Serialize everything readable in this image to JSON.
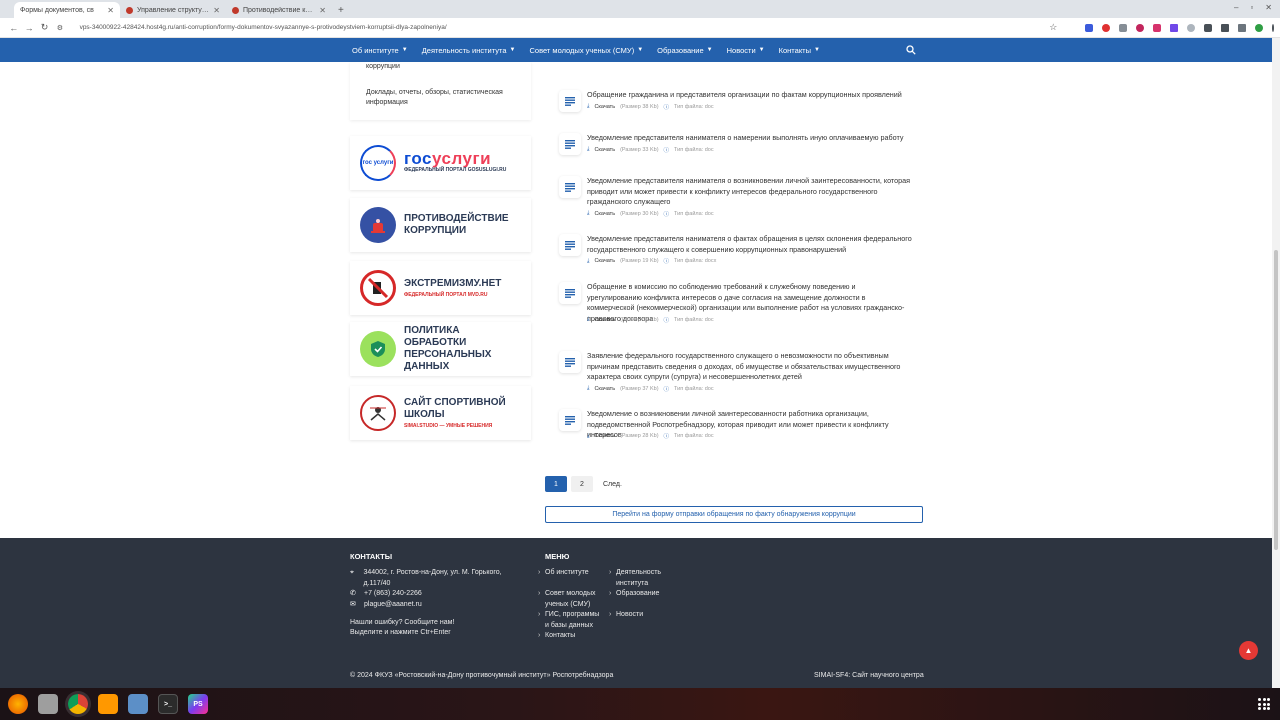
{
  "browser": {
    "tabs": [
      {
        "title": "Формы документов, св",
        "active": true
      },
      {
        "title": "Управление структуро",
        "active": false
      },
      {
        "title": "Противодействие корр",
        "active": false
      }
    ],
    "new_tab": "+",
    "url": "vps-34000922-428424.host4g.ru/anti-corruption/formy-dokumentov-svyazannye-s-protivodeystviem-korruptsii-dlya-zapolneniya/"
  },
  "nav": {
    "items": [
      {
        "label": "Об институте"
      },
      {
        "label": "Деятельность института"
      },
      {
        "label": "Совет молодых ученых (СМУ)"
      },
      {
        "label": "Образование"
      },
      {
        "label": "Новости"
      },
      {
        "label": "Контакты"
      }
    ]
  },
  "sidebar": {
    "links": [
      "коррупции",
      "Доклады, отчеты, обзоры, статистическая информация"
    ],
    "banners": [
      {
        "title_a": "гос",
        "title_b": "услуги",
        "subtitle": "ФЕДЕРАЛЬНЫЙ ПОРТАЛ GOSUSLUGI.RU",
        "logo_text": "гос услуги"
      },
      {
        "title": "ПРОТИВОДЕЙСТВИЕ КОРРУПЦИИ",
        "subtitle": ""
      },
      {
        "title": "ЭКСТРЕМИЗМУ.НЕТ",
        "subtitle": "ФЕДЕРАЛЬНЫЙ ПОРТАЛ MVD.RU"
      },
      {
        "title": "ПОЛИТИКА ОБРАБОТКИ ПЕРСОНАЛЬНЫХ ДАННЫХ",
        "subtitle": ""
      },
      {
        "title": "САЙТ СПОРТИВНОЙ ШКОЛЫ",
        "subtitle": "SIMAI.STUDIO — УМНЫЕ РЕШЕНИЯ"
      }
    ]
  },
  "documents": [
    {
      "title": "Обращение гражданина и представителя организации по фактам коррупционных проявлений",
      "download": "Скачать",
      "size": "(Размер 38 Kb)",
      "type": "Тип файла: doc"
    },
    {
      "title": "Уведомление представителя нанимателя о намерении выполнять иную оплачиваемую работу",
      "download": "Скачать",
      "size": "(Размер 33 Kb)",
      "type": "Тип файла: doc"
    },
    {
      "title": "Уведомление представителя нанимателя о возникновении личной заинтересованности, которая приводит или может привести к конфликту интересов федерального государственного гражданского служащего",
      "download": "Скачать",
      "size": "(Размер 30 Kb)",
      "type": "Тип файла: doc"
    },
    {
      "title": "Уведомление представителя нанимателя о фактах обращения в целях склонения федерального государственного служащего к совершению коррупционных правонарушений",
      "download": "Скачать",
      "size": "(Размер 19 Kb)",
      "type": "Тип файла: docx"
    },
    {
      "title": "Обращение в комиссию по соблюдению требований к служебному поведению и урегулированию конфликта интересов о даче согласия на замещение должности в коммерческой (некоммерческой) организации или выполнение работ на условиях гражданско-правового договора",
      "download": "Скачать",
      "size": "(Размер 36 Kb)",
      "type": "Тип файла: doc"
    },
    {
      "title": "Заявление федерального государственного служащего о невозможности по объективным причинам представить сведения о доходах, об имуществе и обязательствах имущественного характера своих супруги (супруга) и несовершеннолетних детей",
      "download": "Скачать",
      "size": "(Размер 37 Kb)",
      "type": "Тип файла: doc"
    },
    {
      "title": "Уведомление о возникновении личной заинтересованности работника организации, подведомственной Роспотребнадзору, которая приводит или может привести к конфликту интересов",
      "download": "Скачать",
      "size": "(Размер 28 Kb)",
      "type": "Тип файла: doc"
    }
  ],
  "pagination": {
    "pages": [
      "1",
      "2"
    ],
    "current": "1",
    "next": "След."
  },
  "report_button": "Перейти на форму отправки обращения по факту обнаружения коррупции",
  "footer": {
    "contacts_title": "КОНТАКТЫ",
    "address": "344002, г. Ростов-на-Дону, ул. М. Горького, д.117/40",
    "phone": "+7 (863) 240-2266",
    "email": "plague@aaanet.ru",
    "error_line1": "Нашли ошибку? Сообщите нам!",
    "error_line2": "Выделите и нажмите Ctr+Enter",
    "menu_title": "МЕНЮ",
    "menu_col1": [
      "Об институте",
      "Совет молодых ученых (СМУ)",
      "ГИС, программы и базы данных",
      "Контакты"
    ],
    "menu_col2": [
      "Деятельность института",
      "Образование",
      "Новости"
    ],
    "copyright": "© 2024 ФКУЗ «Ростовский-на-Дону противочумный институт» Роспотребнадзора",
    "brand": "SIMAI-SF4: Сайт научного центра"
  },
  "colors": {
    "nav": "#2461ad",
    "footer": "#2d3440",
    "accent_red": "#e53935"
  }
}
